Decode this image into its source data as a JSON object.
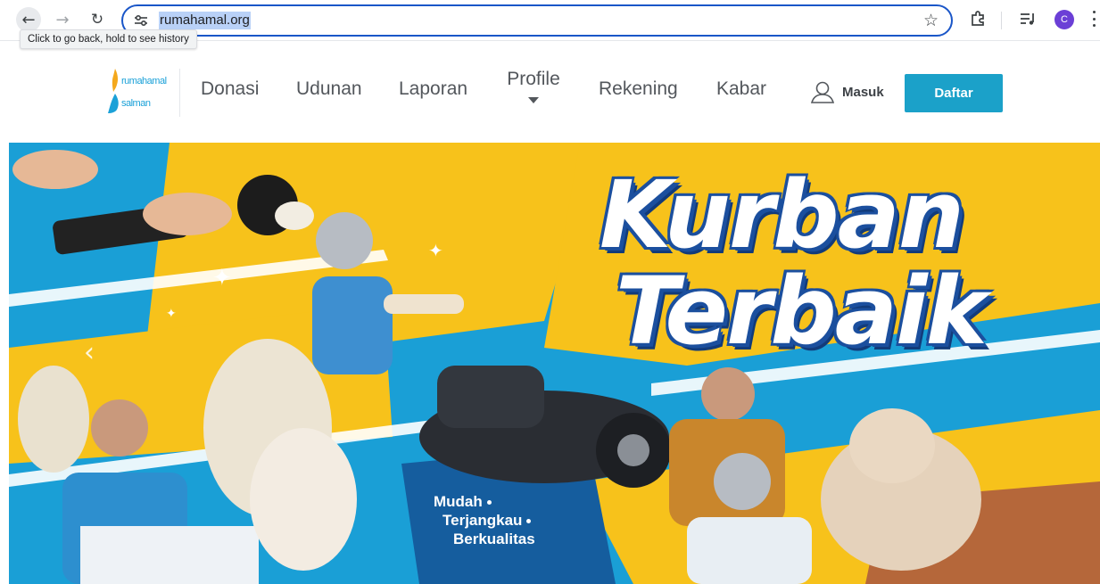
{
  "browser": {
    "url": "rumahamal.org",
    "back_tooltip": "Click to go back, hold to see history",
    "profile_initial": "C",
    "icons": [
      "back-arrow-icon",
      "forward-arrow-icon",
      "reload-icon",
      "site-info-icon",
      "bookmark-star-icon",
      "extensions-icon",
      "media-controls-icon",
      "profile-avatar",
      "menu-dots-icon"
    ]
  },
  "site": {
    "logo": {
      "line1": "rumahamal",
      "line2": "salman"
    },
    "nav": {
      "donasi": "Donasi",
      "udunan": "Udunan",
      "laporan": "Laporan",
      "profile": "Profile",
      "rekening": "Rekening",
      "kabar": "Kabar"
    },
    "login_label": "Masuk",
    "register_label": "Daftar",
    "colors": {
      "brand": "#1ba1c9",
      "hero_blue": "#1a9fd6",
      "hero_yellow": "#f7c21b"
    }
  },
  "hero": {
    "headline_line1": "Kurban",
    "headline_line2": "Terbaik",
    "tagline": [
      "Mudah",
      "Terjangkau",
      "Berkualitas"
    ],
    "prev_arrow": "‹"
  }
}
